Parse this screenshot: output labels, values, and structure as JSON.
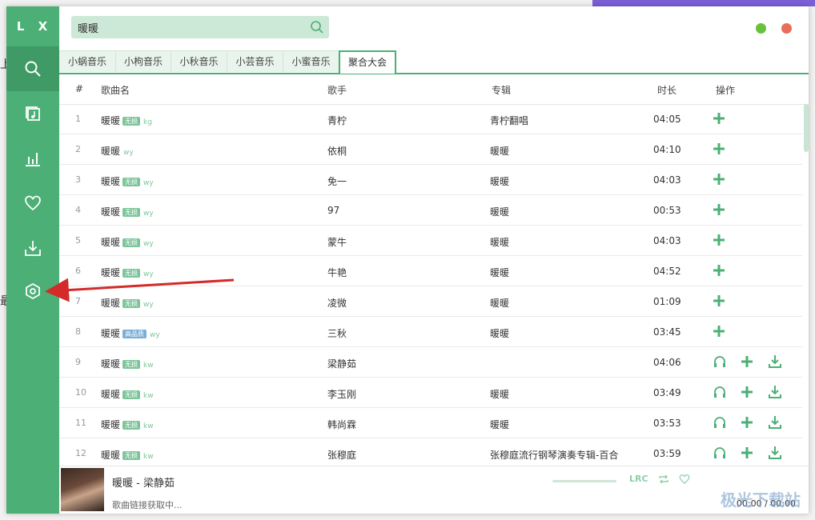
{
  "sidebar": {
    "logo": "L X"
  },
  "search": {
    "value": "暖暖"
  },
  "tabs": [
    "小蜗音乐",
    "小枸音乐",
    "小秋音乐",
    "小芸音乐",
    "小蜜音乐",
    "聚合大会"
  ],
  "table": {
    "headers": {
      "index": "#",
      "song": "歌曲名",
      "artist": "歌手",
      "album": "专辑",
      "duration": "时长",
      "actions": "操作"
    },
    "rows": [
      {
        "index": "1",
        "song": "暖暖",
        "badge": "无损",
        "source": "kg",
        "artist": "青柠",
        "album": "青柠翻唱",
        "duration": "04:05"
      },
      {
        "index": "2",
        "song": "暖暖",
        "badge": "",
        "source": "wy",
        "artist": "依桐",
        "album": "暖暖",
        "duration": "04:10"
      },
      {
        "index": "3",
        "song": "暖暖",
        "badge": "无损",
        "source": "wy",
        "artist": "免一",
        "album": "暖暖",
        "duration": "04:03"
      },
      {
        "index": "4",
        "song": "暖暖",
        "badge": "无损",
        "source": "wy",
        "artist": "97",
        "album": "暖暖",
        "duration": "00:53"
      },
      {
        "index": "5",
        "song": "暖暖",
        "badge": "无损",
        "source": "wy",
        "artist": "蒙牛",
        "album": "暖暖",
        "duration": "04:03"
      },
      {
        "index": "6",
        "song": "暖暖",
        "badge": "无损",
        "source": "wy",
        "artist": "牛艳",
        "album": "暖暖",
        "duration": "04:52"
      },
      {
        "index": "7",
        "song": "暖暖",
        "badge": "无损",
        "source": "wy",
        "artist": "凌微",
        "album": "暖暖",
        "duration": "01:09"
      },
      {
        "index": "8",
        "song": "暖暖",
        "badge": "高品质",
        "source": "wy",
        "artist": "三秋",
        "album": "暖暖",
        "duration": "03:45"
      },
      {
        "index": "9",
        "song": "暖暖",
        "badge": "无损",
        "source": "kw",
        "artist": "梁静茹",
        "album": "",
        "duration": "04:06"
      },
      {
        "index": "10",
        "song": "暖暖",
        "badge": "无损",
        "source": "kw",
        "artist": "李玉刚",
        "album": "暖暖",
        "duration": "03:49"
      },
      {
        "index": "11",
        "song": "暖暖",
        "badge": "无损",
        "source": "kw",
        "artist": "韩尚霖",
        "album": "暖暖",
        "duration": "03:53"
      },
      {
        "index": "12",
        "song": "暖暖",
        "badge": "无损",
        "source": "kw",
        "artist": "张穆庭",
        "album": "张穆庭流行钢琴演奏专辑-百合",
        "duration": "03:59"
      }
    ]
  },
  "player": {
    "title": "暖暖 - 梁静茹",
    "status": "歌曲链接获取中...",
    "time": "00:00 / 00:00",
    "lrc_label": "LRC"
  },
  "watermark": "极光下载站",
  "background_text": {
    "char_top": "上",
    "char_mid": "最"
  },
  "colors": {
    "accent": "#4caf75",
    "min_button": "#67c23a",
    "close_button": "#ea6c5a"
  }
}
